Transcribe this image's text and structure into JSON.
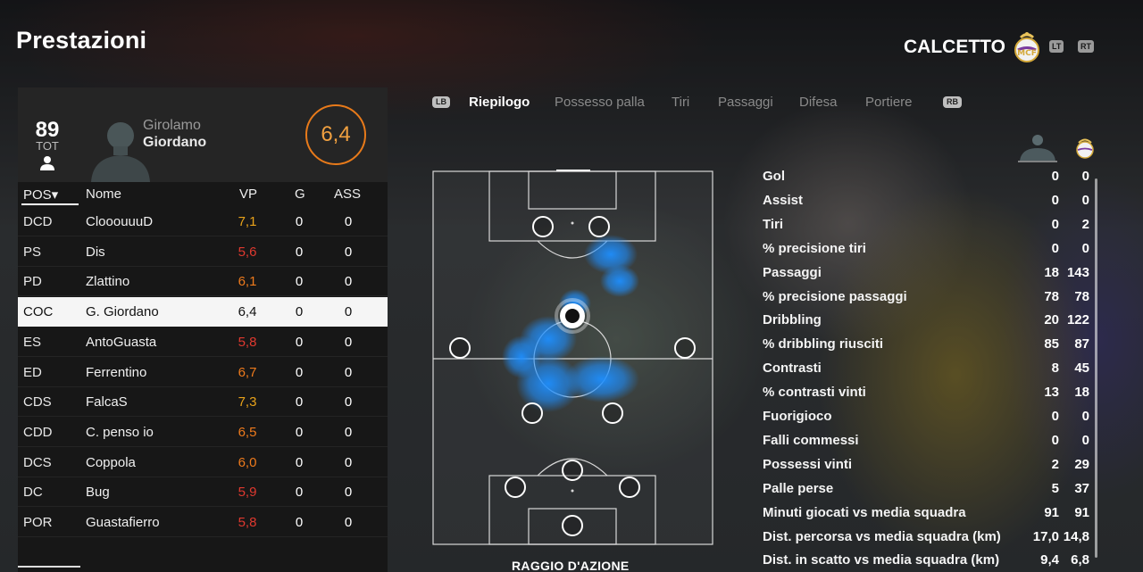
{
  "header": {
    "title": "Prestazioni",
    "mode": "CALCETTO",
    "lt_label": "LT",
    "rt_label": "RT"
  },
  "player": {
    "overall": "89",
    "overall_label": "TOT",
    "first_name": "Girolamo",
    "last_name": "Giordano",
    "match_rating": "6,4"
  },
  "table": {
    "headers": {
      "pos": "POS▾",
      "name": "Nome",
      "vp": "VP",
      "g": "G",
      "ass": "ASS"
    },
    "rows": [
      {
        "pos": "DCD",
        "name": "ClooouuuD",
        "vp": "7,1",
        "g": "0",
        "ass": "0",
        "vp_color": "#e8a21a"
      },
      {
        "pos": "PS",
        "name": "Dis",
        "vp": "5,6",
        "g": "0",
        "ass": "0",
        "vp_color": "#e0392f"
      },
      {
        "pos": "PD",
        "name": "Zlattino",
        "vp": "6,1",
        "g": "0",
        "ass": "0",
        "vp_color": "#ee7a1c"
      },
      {
        "pos": "COC",
        "name": "G. Giordano",
        "vp": "6,4",
        "g": "0",
        "ass": "0",
        "vp_color": "#111111",
        "selected": true
      },
      {
        "pos": "ES",
        "name": "AntoGuasta",
        "vp": "5,8",
        "g": "0",
        "ass": "0",
        "vp_color": "#e0392f"
      },
      {
        "pos": "ED",
        "name": "Ferrentino",
        "vp": "6,7",
        "g": "0",
        "ass": "0",
        "vp_color": "#ee7a1c"
      },
      {
        "pos": "CDS",
        "name": "FalcaS",
        "vp": "7,3",
        "g": "0",
        "ass": "0",
        "vp_color": "#e8a21a"
      },
      {
        "pos": "CDD",
        "name": "C. penso  io",
        "vp": "6,5",
        "g": "0",
        "ass": "0",
        "vp_color": "#ee7a1c"
      },
      {
        "pos": "DCS",
        "name": "Coppola",
        "vp": "6,0",
        "g": "0",
        "ass": "0",
        "vp_color": "#ee7a1c"
      },
      {
        "pos": "DC",
        "name": "Bug",
        "vp": "5,9",
        "g": "0",
        "ass": "0",
        "vp_color": "#e0392f"
      },
      {
        "pos": "POR",
        "name": "Guastafierro",
        "vp": "5,8",
        "g": "0",
        "ass": "0",
        "vp_color": "#e0392f"
      }
    ]
  },
  "tabs": {
    "lb": "LB",
    "rb": "RB",
    "items": [
      "Riepilogo",
      "Possesso palla",
      "Tiri",
      "Passaggi",
      "Difesa",
      "Portiere"
    ],
    "active": "Riepilogo"
  },
  "pitch": {
    "label": "RAGGIO D'AZIONE"
  },
  "stats": [
    {
      "label": "Gol",
      "player": "0",
      "team": "0"
    },
    {
      "label": "Assist",
      "player": "0",
      "team": "0"
    },
    {
      "label": "Tiri",
      "player": "0",
      "team": "2"
    },
    {
      "label": "% precisione tiri",
      "player": "0",
      "team": "0"
    },
    {
      "label": "Passaggi",
      "player": "18",
      "team": "143"
    },
    {
      "label": "% precisione passaggi",
      "player": "78",
      "team": "78"
    },
    {
      "label": "Dribbling",
      "player": "20",
      "team": "122"
    },
    {
      "label": "% dribbling riusciti",
      "player": "85",
      "team": "87"
    },
    {
      "label": "Contrasti",
      "player": "8",
      "team": "45"
    },
    {
      "label": "% contrasti vinti",
      "player": "13",
      "team": "18"
    },
    {
      "label": "Fuorigioco",
      "player": "0",
      "team": "0"
    },
    {
      "label": "Falli commessi",
      "player": "0",
      "team": "0"
    },
    {
      "label": "Possessi vinti",
      "player": "2",
      "team": "29"
    },
    {
      "label": "Palle perse",
      "player": "5",
      "team": "37"
    },
    {
      "label": "Minuti giocati vs media squadra",
      "player": "91",
      "team": "91"
    },
    {
      "label": "Dist. percorsa vs media squadra (km)",
      "player": "17,0",
      "team": "14,8"
    },
    {
      "label": "Dist. in scatto vs media squadra (km)",
      "player": "9,4",
      "team": "6,8"
    }
  ],
  "colors": {
    "rating_ring": "#e87a1a",
    "heatmap": "#1e8fff"
  }
}
